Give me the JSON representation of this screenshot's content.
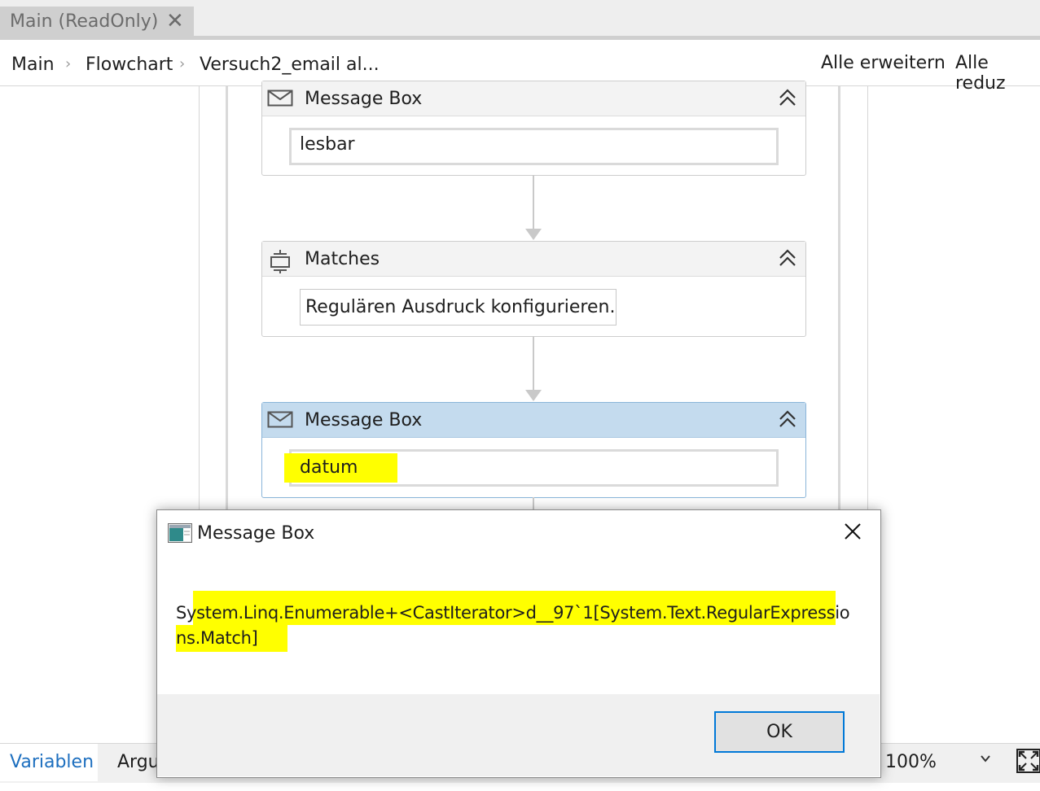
{
  "tab": {
    "title": "Main (ReadOnly)",
    "close_glyph": "✕"
  },
  "breadcrumb": {
    "items": [
      "Main",
      "Flowchart",
      "Versuch2_email al..."
    ],
    "separator": "›"
  },
  "toolbar": {
    "expand_all": "Alle erweitern",
    "collapse_all": "Alle reduz"
  },
  "activities": [
    {
      "title": "Message Box",
      "field": "lesbar",
      "icon": "envelope-icon",
      "selected": false
    },
    {
      "title": "Matches",
      "field": "Regulären Ausdruck konfigurieren...",
      "icon": "matches-icon",
      "selected": false
    },
    {
      "title": "Message Box",
      "field": "datum",
      "icon": "envelope-icon",
      "selected": true,
      "highlighted": true
    }
  ],
  "bottom_bar": {
    "tab_variables": "Variablen",
    "tab_arguments": "Argu",
    "zoom": "100%"
  },
  "dialog": {
    "title": "Message Box",
    "message_line1": "System.Linq.Enumerable+<CastIterator>d__97`1[System.Text.RegularExpressio",
    "message_line2": "ns.Match]",
    "ok_label": "OK"
  },
  "colors": {
    "highlight": "#ffff00",
    "selected_header": "#c4dbee",
    "link_blue": "#1d6fbf",
    "ok_border": "#0078d7"
  }
}
